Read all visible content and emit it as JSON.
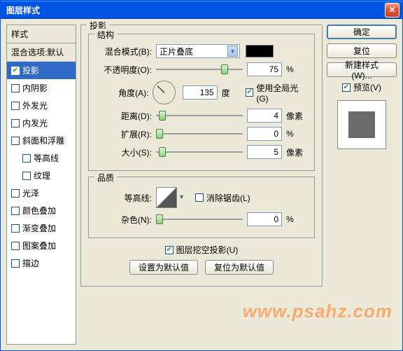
{
  "window": {
    "title": "图层样式"
  },
  "styles": {
    "header": "样式",
    "blending": "混合选项:默认",
    "items": [
      {
        "label": "投影",
        "checked": true,
        "selected": true
      },
      {
        "label": "内阴影",
        "checked": false
      },
      {
        "label": "外发光",
        "checked": false
      },
      {
        "label": "内发光",
        "checked": false
      },
      {
        "label": "斜面和浮雕",
        "checked": false
      },
      {
        "label": "等高线",
        "checked": false,
        "indent": true
      },
      {
        "label": "纹理",
        "checked": false,
        "indent": true
      },
      {
        "label": "光泽",
        "checked": false
      },
      {
        "label": "颜色叠加",
        "checked": false
      },
      {
        "label": "渐变叠加",
        "checked": false
      },
      {
        "label": "图案叠加",
        "checked": false
      },
      {
        "label": "描边",
        "checked": false
      }
    ]
  },
  "panel": {
    "title": "投影",
    "structure": {
      "legend": "结构",
      "blendMode": {
        "label": "混合模式(B):",
        "value": "正片叠底",
        "color": "#000000"
      },
      "opacity": {
        "label": "不透明度(O):",
        "value": "75",
        "unit": "%",
        "pos": 75
      },
      "angle": {
        "label": "角度(A):",
        "value": "135",
        "unit": "度",
        "globalLight": "使用全局光(G)",
        "globalChecked": true
      },
      "distance": {
        "label": "距离(D):",
        "value": "4",
        "unit": "像素",
        "pos": 3
      },
      "spread": {
        "label": "扩展(R):",
        "value": "0",
        "unit": "%",
        "pos": 0
      },
      "size": {
        "label": "大小(S):",
        "value": "5",
        "unit": "像素",
        "pos": 3
      }
    },
    "quality": {
      "legend": "品质",
      "contour": {
        "label": "等高线:",
        "antialias": "消除锯齿(L)",
        "antialiasChecked": false
      },
      "noise": {
        "label": "杂色(N):",
        "value": "0",
        "unit": "%",
        "pos": 0
      }
    },
    "knockout": {
      "label": "图层挖空投影(U)",
      "checked": true
    },
    "buttons": {
      "default": "设置为默认值",
      "reset": "复位为默认值"
    }
  },
  "right": {
    "ok": "确定",
    "cancel": "复位",
    "newStyle": "新建样式(W)...",
    "preview": "预览(V)",
    "previewChecked": true
  },
  "watermark": "www.psahz.com"
}
